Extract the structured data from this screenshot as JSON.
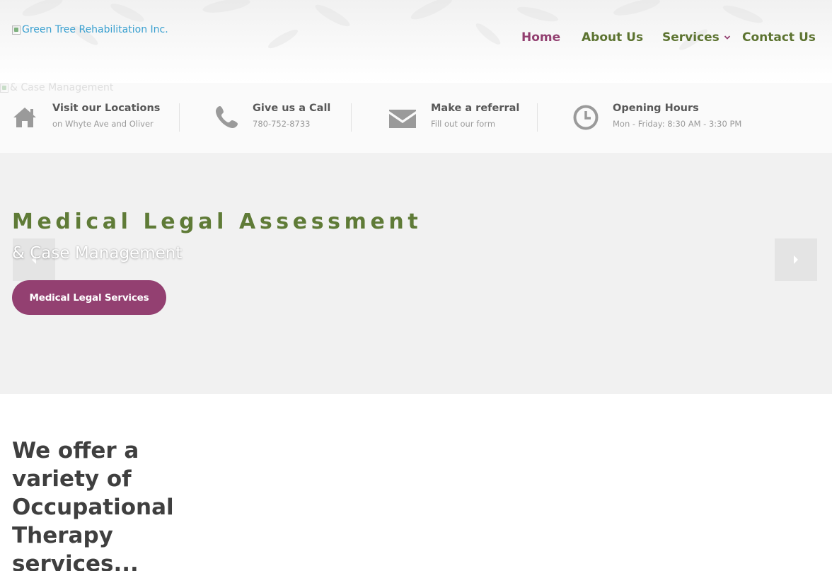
{
  "header": {
    "logo_alt": "Green Tree Rehabilitation Inc.",
    "nav": [
      {
        "label": "Home",
        "active": true
      },
      {
        "label": "About Us",
        "active": false
      },
      {
        "label": "Services",
        "active": false,
        "has_dropdown": true
      },
      {
        "label": "Contact Us",
        "active": false
      }
    ]
  },
  "infobar": {
    "image_alt": "& Case Management",
    "items": [
      {
        "icon": "home-icon",
        "title": "Visit our Locations",
        "subtitle": "on Whyte Ave and Oliver"
      },
      {
        "icon": "phone-icon",
        "title": "Give us a Call",
        "subtitle": "780-752-8733"
      },
      {
        "icon": "envelope-icon",
        "title": "Make a referral",
        "subtitle": "Fill out our form"
      },
      {
        "icon": "clock-icon",
        "title": "Opening Hours",
        "subtitle": "Mon - Friday: 8:30 AM - 3:30 PM"
      }
    ]
  },
  "hero": {
    "title": "Medical Legal Assessment",
    "subtitle": "& Case Management",
    "cta_label": "Medical Legal Services"
  },
  "intro": {
    "heading": "We offer a variety of Occupational Therapy services..."
  },
  "colors": {
    "nav_active": "#923f70",
    "nav_default": "#5c7330",
    "hero_title": "#5f7b37",
    "cta_background": "#934071",
    "icon_gray": "#9a9a9a"
  }
}
